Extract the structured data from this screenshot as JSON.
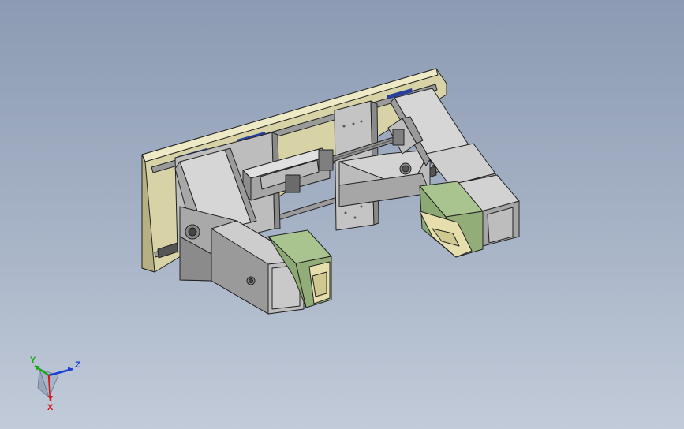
{
  "viewport": {
    "background_top": "#8c9bb3",
    "background_bottom": "#c2cbd9"
  },
  "model": {
    "colors": {
      "base_plate": "#d8d3a6",
      "base_plate_edge": "#b6b083",
      "steel_light": "#c9c9c9",
      "steel_mid": "#a9a9a9",
      "steel_dark": "#7b7b7b",
      "pad_green": "#a9c48f",
      "pad_cream": "#e6dfad",
      "rail_blue": "#2a3f9a",
      "outline": "#222222"
    }
  },
  "triad": {
    "x_label": "X",
    "y_label": "Y",
    "z_label": "Z",
    "x_color": "#d11a1a",
    "y_color": "#18a81a",
    "z_color": "#1a3fd1"
  }
}
